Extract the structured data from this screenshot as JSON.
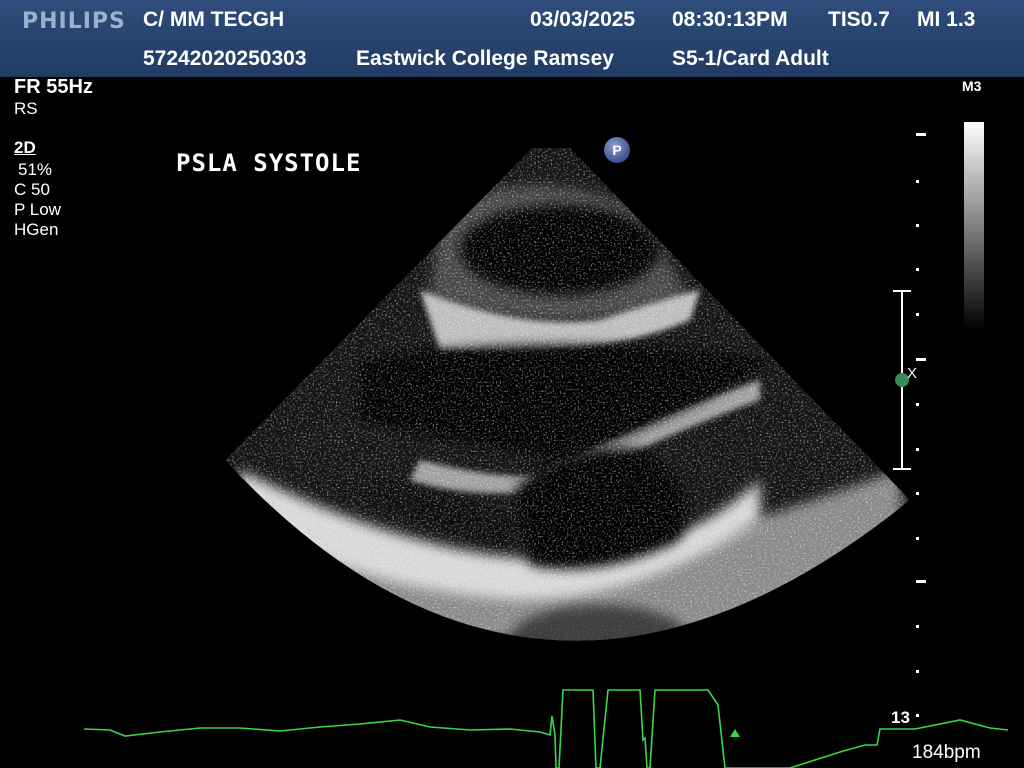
{
  "header": {
    "logo": "PHILIPS",
    "exam_type": "C/ MM TECGH",
    "date": "03/03/2025",
    "time": "08:30:13PM",
    "tis": "TIS0.7",
    "mi": "MI 1.3",
    "patient_id": "57242020250303",
    "institution": "Eastwick College Ramsey",
    "transducer_preset": "S5-1/Card Adult"
  },
  "params": {
    "frame_rate": "FR 55Hz",
    "resolution_speed": "RS",
    "mode": "2D",
    "gain": "51%",
    "compression": "C 50",
    "power": "P Low",
    "frequency": "HGen"
  },
  "image": {
    "annotation": "PSLA SYSTOLE",
    "p_marker": "P"
  },
  "right_panel": {
    "map": "M3",
    "focus_marker": "X",
    "depth": "13"
  },
  "ecg": {
    "heart_rate": "184bpm",
    "trace_color": "#39d64a"
  }
}
